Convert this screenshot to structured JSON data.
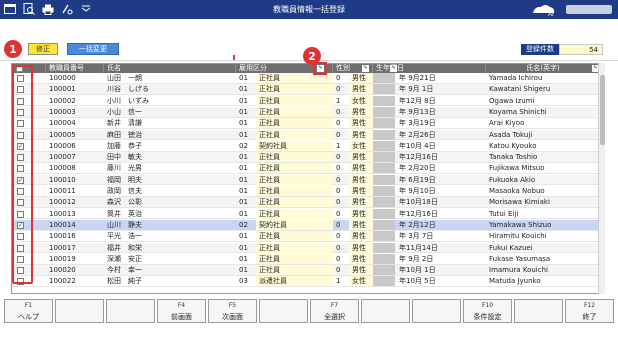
{
  "window": {
    "title": "教職員情報一括登録"
  },
  "toolbar": {
    "icons": [
      "window-icon",
      "search-doc-icon",
      "print-icon",
      "export-icon",
      "format-icon",
      "dropdown-icon"
    ],
    "edit_mode_label": "修正",
    "bulk_change_label": "一括変更",
    "record_count_label": "登録件数",
    "record_count_value": "54"
  },
  "annotations": {
    "marker1": "1",
    "marker2": "2"
  },
  "table": {
    "headers": {
      "id": "教職員番号",
      "name": "氏名",
      "employment": "雇用区分",
      "gender": "性別",
      "birthdate": "生年月日",
      "name_en": "氏名(英字)"
    },
    "rows": [
      {
        "checked": "",
        "id": "100000",
        "name": "山田　一朗",
        "emp_code": "01",
        "emp": "正社員",
        "g_code": "0",
        "gender": "男性",
        "birth": "年 9月21日",
        "en": "Yamada Ichirou"
      },
      {
        "checked": "",
        "id": "100001",
        "name": "川谷　しげる",
        "emp_code": "01",
        "emp": "正社員",
        "g_code": "0",
        "gender": "男性",
        "birth": "年 9月 1日",
        "en": "Kawatani Shigeru"
      },
      {
        "checked": "",
        "id": "100002",
        "name": "小川　いずみ",
        "emp_code": "01",
        "emp": "正社員",
        "g_code": "1",
        "gender": "女性",
        "birth": "年12月 8日",
        "en": "Ogawa Izumi"
      },
      {
        "checked": "",
        "id": "100003",
        "name": "小山　信一",
        "emp_code": "01",
        "emp": "正社員",
        "g_code": "0",
        "gender": "男性",
        "birth": "年 9月13日",
        "en": "Koyama Shinichi"
      },
      {
        "checked": "",
        "id": "100004",
        "name": "新井　清謙",
        "emp_code": "01",
        "emp": "正社員",
        "g_code": "0",
        "gender": "男性",
        "birth": "年 3月19日",
        "en": "Arai Kiyoo"
      },
      {
        "checked": "",
        "id": "100005",
        "name": "麻田　徳治",
        "emp_code": "01",
        "emp": "正社員",
        "g_code": "0",
        "gender": "男性",
        "birth": "年 2月26日",
        "en": "Asada Tokuji"
      },
      {
        "checked": "✓",
        "id": "100006",
        "name": "加藤　恭子",
        "emp_code": "02",
        "emp": "契約社員",
        "g_code": "1",
        "gender": "女性",
        "birth": "年10月 4日",
        "en": "Katou Kyouko"
      },
      {
        "checked": "",
        "id": "100007",
        "name": "田中　敏夫",
        "emp_code": "01",
        "emp": "正社員",
        "g_code": "0",
        "gender": "男性",
        "birth": "年12月16日",
        "en": "Tanaka Toshio"
      },
      {
        "checked": "",
        "id": "100008",
        "name": "藤川　光男",
        "emp_code": "01",
        "emp": "正社員",
        "g_code": "0",
        "gender": "男性",
        "birth": "年 2月20日",
        "en": "Fujikawa Mitsuo"
      },
      {
        "checked": "✓",
        "id": "100010",
        "name": "福岡　明夫",
        "emp_code": "01",
        "emp": "正社員",
        "g_code": "0",
        "gender": "男性",
        "birth": "年 6月19日",
        "en": "Fukuoka Akio"
      },
      {
        "checked": "",
        "id": "100011",
        "name": "政岡　信夫",
        "emp_code": "01",
        "emp": "正社員",
        "g_code": "0",
        "gender": "男性",
        "birth": "年 9月10日",
        "en": "Masaoka Nobuo"
      },
      {
        "checked": "",
        "id": "100012",
        "name": "森沢　公彰",
        "emp_code": "01",
        "emp": "正社員",
        "g_code": "0",
        "gender": "男性",
        "birth": "年10月18日",
        "en": "Morisawa Kimiaki"
      },
      {
        "checked": "",
        "id": "100013",
        "name": "筒井　英治",
        "emp_code": "01",
        "emp": "正社員",
        "g_code": "0",
        "gender": "男性",
        "birth": "年12月16日",
        "en": "Tutui Eiji"
      },
      {
        "checked": "✓",
        "id": "100014",
        "name": "山川　静夫",
        "emp_code": "02",
        "emp": "契約社員",
        "g_code": "0",
        "gender": "男性",
        "birth": "年 2月12日",
        "en": "Yamakawa Shizuo",
        "selected": true
      },
      {
        "checked": "",
        "id": "100016",
        "name": "平光　浩一",
        "emp_code": "01",
        "emp": "正社員",
        "g_code": "0",
        "gender": "男性",
        "birth": "年 3月 7日",
        "en": "Hiramitu Kouichi"
      },
      {
        "checked": "",
        "id": "100017",
        "name": "福井　和栄",
        "emp_code": "01",
        "emp": "正社員",
        "g_code": "0",
        "gender": "男性",
        "birth": "年11月14日",
        "en": "Fukui Kazuei"
      },
      {
        "checked": "",
        "id": "100019",
        "name": "深瀬　安正",
        "emp_code": "01",
        "emp": "正社員",
        "g_code": "0",
        "gender": "男性",
        "birth": "年 9月 2日",
        "en": "Fukase Yasumasa"
      },
      {
        "checked": "",
        "id": "100020",
        "name": "今村　幸一",
        "emp_code": "01",
        "emp": "正社員",
        "g_code": "0",
        "gender": "男性",
        "birth": "年10月 1日",
        "en": "Imamura Kouichi"
      },
      {
        "checked": "",
        "id": "100022",
        "name": "松田　純子",
        "emp_code": "03",
        "emp": "派遣社員",
        "g_code": "1",
        "gender": "女性",
        "birth": "年10月 5日",
        "en": "Matuda Jyunko"
      }
    ]
  },
  "fkeys": [
    {
      "fn": "F1",
      "label": "ヘルプ"
    },
    {
      "fn": "",
      "label": ""
    },
    {
      "fn": "",
      "label": ""
    },
    {
      "fn": "F4",
      "label": "前画面"
    },
    {
      "fn": "F5",
      "label": "次画面"
    },
    {
      "fn": "",
      "label": ""
    },
    {
      "fn": "F7",
      "label": "全選択"
    },
    {
      "fn": "",
      "label": ""
    },
    {
      "fn": "",
      "label": ""
    },
    {
      "fn": "F10",
      "label": "条件設定"
    },
    {
      "fn": "",
      "label": ""
    },
    {
      "fn": "F12",
      "label": "終了"
    }
  ]
}
